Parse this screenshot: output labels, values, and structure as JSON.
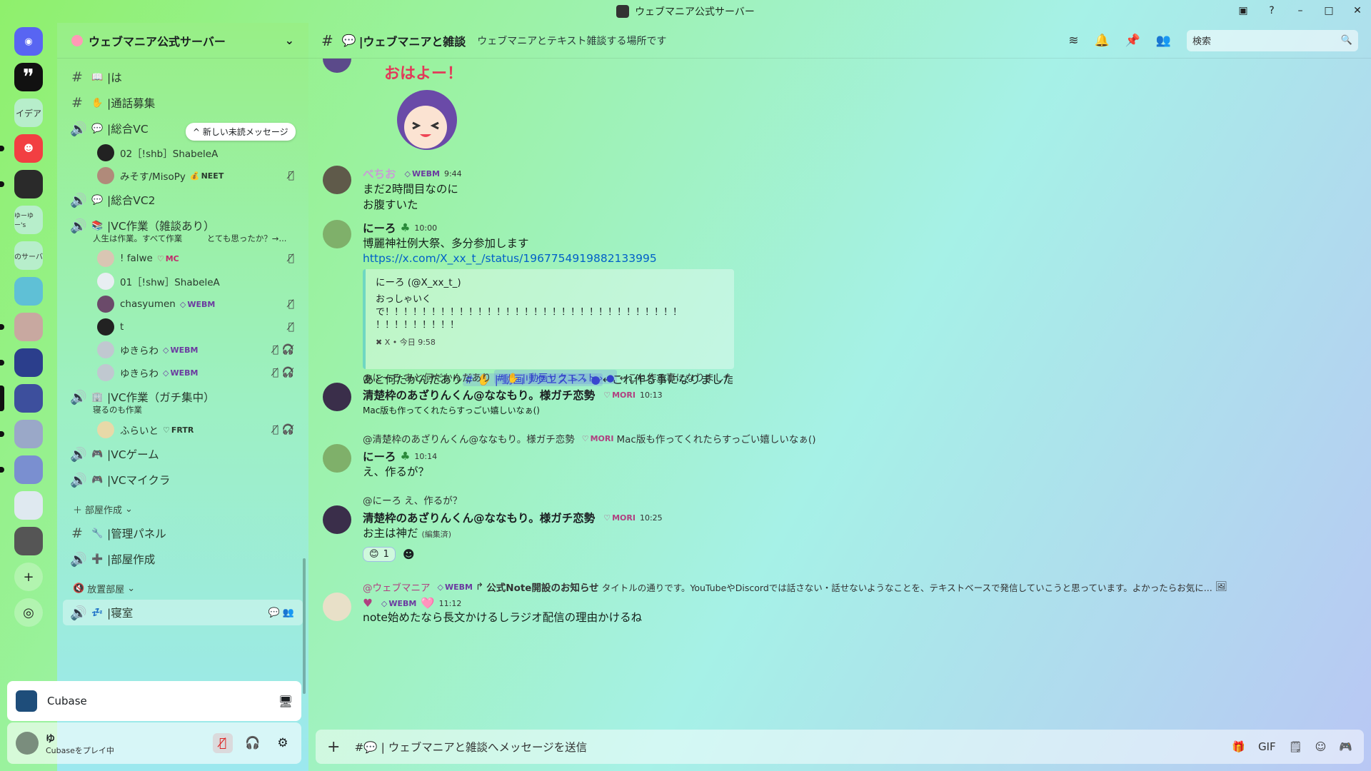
{
  "window": {
    "title": "ウェブマニア公式サーバー"
  },
  "rail": {
    "items": [
      {
        "label": ""
      },
      {
        "label": ""
      },
      {
        "label": "イデア"
      },
      {
        "label": ""
      },
      {
        "label": ""
      },
      {
        "label": "ゆーゆー's"
      },
      {
        "label": "のサーバ"
      }
    ]
  },
  "sidebar": {
    "server_name": "ウェブマニア公式サーバー",
    "new_unread": "新しい未読メッセージ",
    "channels": [
      {
        "label": "|は"
      },
      {
        "label": "|通話募集"
      },
      {
        "label": "|総合VC"
      },
      {
        "label": "|総合VC2"
      },
      {
        "label": "|VC作業（雑談あり）",
        "sub": "人生は作業。すべて作業　　　とても思ったか？→..."
      },
      {
        "label": "|VC作業（ガチ集中）",
        "sub": "寝るのも作業"
      },
      {
        "label": "|VCゲーム"
      },
      {
        "label": "|VCマイクラ"
      },
      {
        "label": "|管理パネル"
      },
      {
        "label": "|部屋作成"
      },
      {
        "label": "|寝室"
      }
    ],
    "users": [
      {
        "name": "02［!shb］ShabeleA"
      },
      {
        "name": "みそす/MisoPy",
        "tag": "NEET"
      },
      {
        "name": "! falwe",
        "tag": "MC"
      },
      {
        "name": "01［!shw］ShabeleA"
      },
      {
        "name": "chasyumen",
        "tag": "WEBM"
      },
      {
        "name": "t"
      },
      {
        "name": "ゆきらわ",
        "tag": "WEBM"
      },
      {
        "name": "ゆきらわ",
        "tag": "WEBM"
      },
      {
        "name": "ふらいと",
        "tag": "FRTR"
      }
    ],
    "categories": {
      "room": "部屋作成",
      "idle": "放置部屋"
    }
  },
  "activity": {
    "name": "Cubase"
  },
  "user": {
    "name": "ゆ",
    "status": "Cubaseをプレイ中"
  },
  "header": {
    "channel": "|ウェブマニアと雑談",
    "topic": "ウェブマニアとテキスト雑談する場所です",
    "search_placeholder": "検索"
  },
  "messages": {
    "sticker_text": "おはよー！",
    "m1": {
      "author": "べちお",
      "tag": "WEBM",
      "time": "9:44",
      "line1": "まだ2時間目なのに",
      "line2": "お腹すいた"
    },
    "m2": {
      "author": "にーろ",
      "time": "10:00",
      "line1": "博麗神社例大祭、多分参加します",
      "link": "https://x.com/X_xx_t_/status/1967754919882133995",
      "embed_author": "にーろ (@X_xx_t_)",
      "embed_line1": "おっしゃいく",
      "embed_line2": "で！！！！！！！！！！！！！！！！！！！！！！！！！！！！！！！！",
      "embed_line3": "！！！！！！！！！",
      "embed_footer": "X • 今日 9:58",
      "line2a": "あと何だかんだあり",
      "mention": "#  ✋ | 動画リクエスト › ●",
      "line2b": "←これ作る事になりました"
    },
    "m3": {
      "reply": "@にーろ あと何だかんだあり",
      "reply_mention": "# ✋ | 動画リクエスト › ●",
      "reply_tail": "←これ作る事になりました",
      "author": "清楚枠のあざりんくん@ななもり。様ガチ恋勢",
      "tag": "MORI",
      "time": "10:13",
      "text": "Mac版も作ってくれたらすっごい嬉しいなぁ()"
    },
    "m4": {
      "reply": "@清楚枠のあざりんくん@ななもり。様ガチ恋勢",
      "reply_tag": "MORI",
      "reply_tail": "Mac版も作ってくれたらすっごい嬉しいなぁ()",
      "author": "にーろ",
      "time": "10:14",
      "text": "え、作るが？"
    },
    "m5": {
      "reply": "@にーろ え、作るが？",
      "author": "清楚枠のあざりんくん@ななもり。様ガチ恋勢",
      "tag": "MORI",
      "time": "10:25",
      "text": "お主は神だ",
      "edited": "(編集済)",
      "reaction_count": "1"
    },
    "m6": {
      "reply": "@ウェブマニア",
      "reply_tag": "WEBM",
      "reply_title": "公式Note開設のお知らせ",
      "reply_tail": "タイトルの通りです。YouTubeやDiscordでは話さない・話せないようなことを、テキストベースで発信していこうと思っています。よかったらお気に...",
      "tag": "WEBM",
      "time": "11:12",
      "text": "note始めたなら長文かけるしラジオ配信の理由かけるね"
    }
  },
  "composer": {
    "placeholder": "#💬 | ウェブマニアと雑談へメッセージを送信"
  }
}
